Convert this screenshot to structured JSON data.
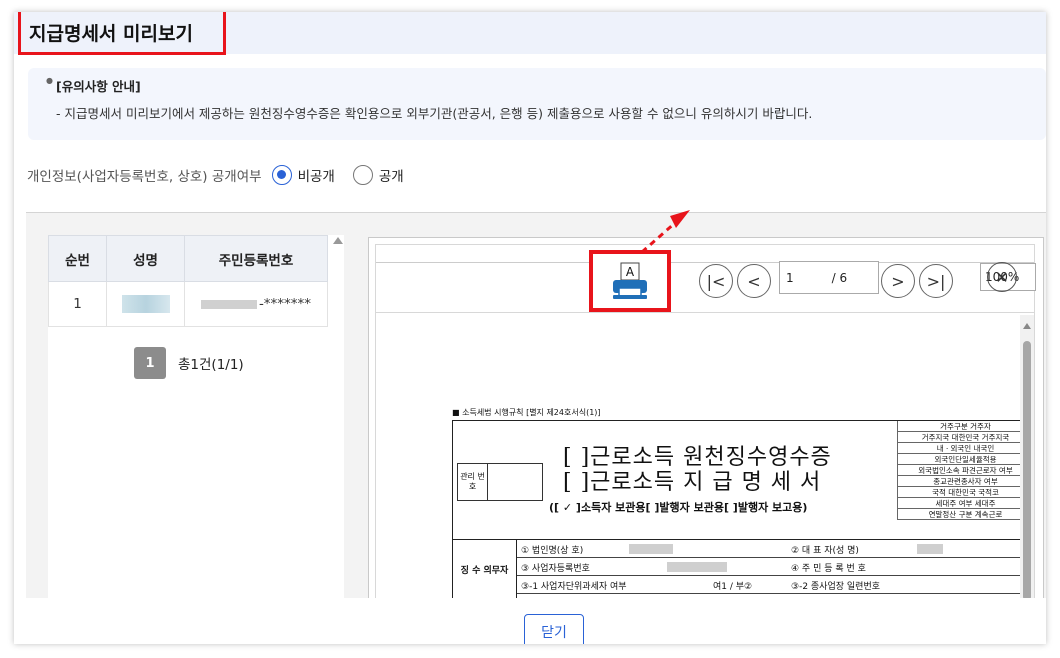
{
  "modal": {
    "title": "지급명세서 미리보기"
  },
  "notice": {
    "title": "[유의사항 안내]",
    "body": "- 지급명세서 미리보기에서 제공하는 원천징수영수증은 확인용으로 외부기관(관공서, 은행 등) 제출용으로 사용할 수 없으니 유의하시기 바랍니다."
  },
  "privacy": {
    "label": "개인정보(사업자등록번호, 상호) 공개여부",
    "options": [
      {
        "label": "비공개",
        "selected": true
      },
      {
        "label": "공개",
        "selected": false
      }
    ]
  },
  "employee_table": {
    "headers": [
      "순번",
      "성명",
      "주민등록번호"
    ],
    "rows": [
      {
        "no": "1",
        "name": "",
        "rrn_suffix": "-*******"
      }
    ]
  },
  "pagination": {
    "page": "1",
    "total": "총1건(1/1)"
  },
  "viewer": {
    "print_icon": "print-icon",
    "page_input": "1",
    "page_total": "/ 6",
    "zoom": "100%",
    "buttons": {
      "first": "|<",
      "prev": "<",
      "next": ">",
      "last": ">|",
      "close": "✕"
    }
  },
  "document": {
    "caption": "■ 소득세법 시행규칙 [별지 제24호서식(1)]",
    "mgmt_label": "관리 번호",
    "title_line1": "[ ]근로소득 원천징수영수증",
    "title_line2": "[ ]근로소득 지 급 명 세 서",
    "subtitle": "([ ✓ ]소득자 보관용[    ]발행자 보관용[    ]발행자 보고용)",
    "side_rows": [
      "거주구분    거주자",
      "거주지국  대한민국  거주지국",
      "내ㆍ외국인    내국인",
      "외국인단일세율적용",
      "외국법인소속 파견근로자 여부",
      "종교관련종사자 여부",
      "국적  대한민국  국적코",
      "세대주 여부    세대주",
      "연말정산 구분   계속근로"
    ],
    "withholder_label": "징 수 의무자",
    "rows": [
      {
        "a": "① 법인명(상 호)",
        "b": "② 대 표 자(성 명)"
      },
      {
        "a": "③ 사업자등록번호",
        "b": "④ 주 민 등 록 번 호"
      },
      {
        "a": "③-1 사업자단위과세자 여부",
        "a2": "여1 / 부②",
        "b": "③-2 종사업장 일련번호"
      }
    ]
  },
  "footer": {
    "close": "닫기"
  },
  "colors": {
    "accent": "#2a62d6",
    "highlight": "#e8141b"
  }
}
